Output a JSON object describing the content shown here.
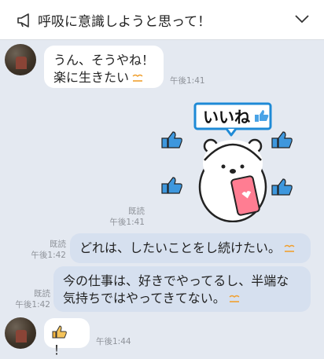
{
  "header": {
    "title": "呼吸に意識しようと思って！",
    "icon_left": "megaphone-icon",
    "icon_right": "chevron-down-icon"
  },
  "messages": [
    {
      "side": "in",
      "lines": [
        "うん、そうやね！",
        "楽に生きたい"
      ],
      "time": "午後1:41"
    },
    {
      "side": "out",
      "type": "sticker",
      "sticker_text": "いいね",
      "read": "既読",
      "time": "午後1:41"
    },
    {
      "side": "out",
      "lines": [
        "どれは、したいことをし続けたい。"
      ],
      "read": "既読",
      "time": "午後1:42"
    },
    {
      "side": "out",
      "lines": [
        "今の仕事は、好きでやってるし、半端な",
        "気持ちではやってきてない。"
      ],
      "read": "既読",
      "time": "午後1:42"
    },
    {
      "side": "in",
      "lines": [
        "！"
      ],
      "time": "午後1:44"
    }
  ]
}
